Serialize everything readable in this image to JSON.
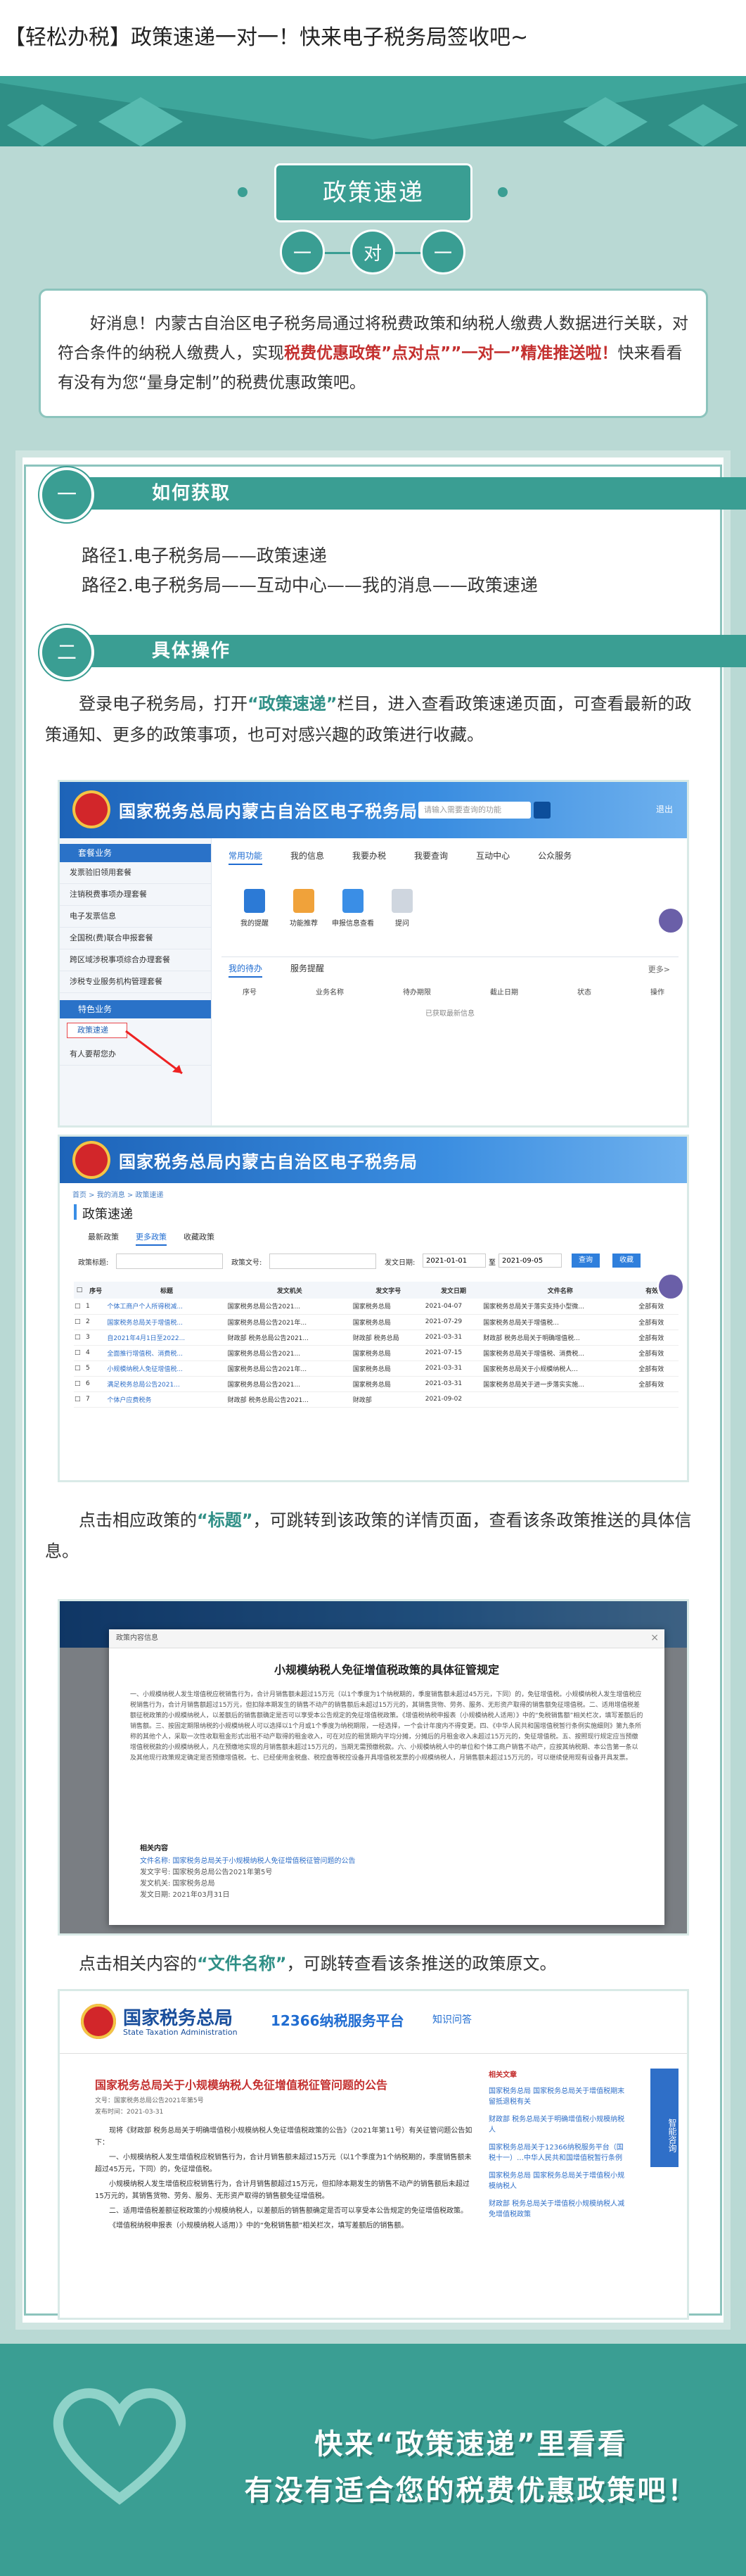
{
  "article": {
    "title": "【轻松办税】政策速递一对一！快来电子税务局签收吧~"
  },
  "section": {
    "ribbon": "政策速递",
    "circles": [
      "一",
      "对",
      "一"
    ]
  },
  "intro": {
    "part1": "好消息！内蒙古自治区电子税务局通过将税费政策和纳税人缴费人数据进行关联，对符合条件的纳税人缴费人，实现",
    "highlight": "税费优惠政策”点对点””一对一”精准推送啦！",
    "part2": "快来看看有没有为您“量身定制”的税费优惠政策吧。"
  },
  "steps": [
    {
      "num": "一",
      "title": "如何获取"
    },
    {
      "num": "二",
      "title": "具体操作"
    }
  ],
  "paths": [
    "路径1.电子税务局——政策速递",
    "路径2.电子税务局——互动中心——我的消息——政策速递"
  ],
  "paragraphs": {
    "p1_a": "登录电子税务局，打开",
    "p1_em": "“政策速递”",
    "p1_b": "栏目，进入查看政策速递页面，可查看最新的政策通知、更多的政策事项，也可对感兴趣的政策进行收藏。",
    "p2_a": "点击相应政策的",
    "p2_em": "“标题”",
    "p2_b": "，可跳转到该政策的详情页面，查看该条政策推送的具体信息。",
    "p3_a": "点击相关内容的",
    "p3_em": "“文件名称”",
    "p3_b": "，可跳转查看该条推送的政策原文。"
  },
  "shot1": {
    "header_title": "国家税务总局内蒙古自治区电子税务局",
    "search_placeholder": "请输入需要查询的功能",
    "util": "退出",
    "sidebar_title": "套餐业务",
    "sidebar_items": [
      "发票验旧领用套餐",
      "注销税费事项办理套餐",
      "电子发票信息",
      "全国税(费)联合申报套餐",
      "跨区域涉税事项综合办理套餐",
      "涉税专业服务机构管理套餐"
    ],
    "sidebar_title2": "特色业务",
    "sidebar_sel": "政策速递",
    "sidebar_item_last": "有人要帮您办",
    "tabs": [
      "常用功能",
      "我的信息",
      "我要办税",
      "我要查询",
      "互动中心",
      "公众服务"
    ],
    "quick": [
      "我的提醒",
      "功能推荐",
      "申报信息查看",
      "提问"
    ],
    "lower_tabs": [
      "我的待办",
      "服务提醒"
    ],
    "lower_more": "更多>",
    "table_cols": [
      "序号",
      "业务名称",
      "待办期限",
      "截止日期",
      "状态",
      "操作"
    ],
    "empty": "已获取最新信息"
  },
  "shot2": {
    "header_title": "国家税务总局内蒙古自治区电子税务局",
    "breadcrumb": "首页 > 我的消息 > 政策速递",
    "page_title": "政策速递",
    "tabs": [
      "最新政策",
      "更多政策",
      "收藏政策"
    ],
    "filters": [
      "政策标题:",
      "政策文号:",
      "发文日期:"
    ],
    "date_from": "2021-01-01",
    "date_sep": "至",
    "date_to": "2021-09-05",
    "btn_search": "查询",
    "btn_reset": "收藏",
    "cols": [
      "序号",
      "标题",
      "发文机关",
      "发文字号",
      "发文日期",
      "文件名称",
      "有效状态"
    ],
    "rows": [
      [
        "1",
        "个体工商户个人所得税减...",
        "国家税务总局公告2021...",
        "国家税务总局",
        "2021-04-07",
        "国家税务总局关于落实支持小型微...",
        "全部有效"
      ],
      [
        "2",
        "国家税务总局关于增值税...",
        "国家税务总局公告2021年...",
        "国家税务总局",
        "2021-07-29",
        "国家税务总局关于增值税...",
        "全部有效"
      ],
      [
        "3",
        "自2021年4月1日至2022...",
        "财政部 税务总局公告2021...",
        "财政部 税务总局",
        "2021-03-31",
        "财政部 税务总局关于明确增值税...",
        "全部有效"
      ],
      [
        "4",
        "全面推行增值税、消费税...",
        "国家税务总局公告2021...",
        "国家税务总局",
        "2021-07-15",
        "国家税务总局关于增值税、消费税...",
        "全部有效"
      ],
      [
        "5",
        "小规模纳税人免征增值税...",
        "国家税务总局公告2021年...",
        "国家税务总局",
        "2021-03-31",
        "国家税务总局关于小规模纳税人...",
        "全部有效"
      ],
      [
        "6",
        "满足税务总局公告2021...",
        "国家税务总局公告2021...",
        "国家税务总局",
        "2021-03-31",
        "国家税务总局关于进一步落实实施...",
        "全部有效"
      ],
      [
        "7",
        "个体户应费税务",
        "财政部 税务总局公告2021...",
        "财政部",
        "2021-09-02",
        "",
        ""
      ]
    ]
  },
  "shot3": {
    "modal_label": "政策内容信息",
    "modal_title": "小规模纳税人免征增值税政策的具体征管规定",
    "modal_body": "一、小规模纳税人发生增值税应税销售行为，合计月销售额未超过15万元（以1个季度为1个纳税期的，季度销售额未超过45万元，下同）的，免征增值税。小规模纳税人发生增值税应税销售行为，合计月销售额超过15万元，但扣除本期发生的销售不动产的销售额后未超过15万元的，其销售货物、劳务、服务、无形资产取得的销售额免征增值税。二、适用增值税差额征税政策的小规模纳税人，以差额后的销售额确定是否可以享受本公告规定的免征增值税政策。《增值税纳税申报表（小规模纳税人适用）》中的“免税销售额”相关栏次，填写差额后的销售额。三、按固定期限纳税的小规模纳税人可以选择以1个月或1个季度为纳税期限，一经选择，一个会计年度内不得变更。四、《中华人民共和国增值税暂行条例实施细则》第九条所称的其他个人，采取一次性收取租金形式出租不动产取得的租金收入，可在对应的租赁期内平均分摊，分摊后的月租金收入未超过15万元的，免征增值税。五、按照现行规定应当预缴增值税税款的小规模纳税人，凡在预缴地实现的月销售额未超过15万元的，当期无需预缴税款。六、小规模纳税人中的单位和个体工商户销售不动产，应按其纳税期、本公告第一条以及其他现行政策规定确定是否预缴增值税。七、已经使用金税盘、税控盘等税控设备开具增值税发票的小规模纳税人，月销售额未超过15万元的，可以继续使用现有设备开具发票。",
    "meta_head": "相关内容",
    "meta": [
      "文件名称:  国家税务总局关于小规模纳税人免征增值税征管问题的公告",
      "发文字号:  国家税务总局公告2021年第5号",
      "发文机关:  国家税务总局",
      "发文日期:  2021年03月31日"
    ]
  },
  "shot4": {
    "org_cn": "国家税务总局",
    "org_en": "State Taxation Administration",
    "hotline": "12366纳税服务平台",
    "smart": "知识问答",
    "doc_title": "国家税务总局关于小规模纳税人免征增值税征管问题的公告",
    "doc_no": "文号：国家税务总局公告2021年第5号",
    "doc_date": "发布时间：2021-03-31",
    "doc_body": [
      "现将《财政部 税务总局关于明确增值税小规模纳税人免征增值税政策的公告》（2021年第11号）有关征管问题公告如下：",
      "一、小规模纳税人发生增值税应税销售行为，合计月销售额未超过15万元（以1个季度为1个纳税期的，季度销售额未超过45万元，下同）的，免征增值税。",
      "小规模纳税人发生增值税应税销售行为，合计月销售额超过15万元，但扣除本期发生的销售不动产的销售额后未超过15万元的，其销售货物、劳务、服务、无形资产取得的销售额免征增值税。",
      "二、适用增值税差额征税政策的小规模纳税人，以差额后的销售额确定是否可以享受本公告规定的免征增值税政策。",
      "《增值税纳税申报表（小规模纳税人适用）》中的“免税销售额”相关栏次，填写差额后的销售额。"
    ],
    "side_head": "相关文章",
    "side_items": [
      "国家税务总局 国家税务总局关于增值税期末留抵退税有关",
      "财政部 税务总局关于明确增值税小规模纳税人",
      "国家税务总局关于12366纳税服务平台（国税十一）…中华人民共和国增值税暂行条例",
      "国家税务总局 国家税务总局关于增值税小规模纳税人",
      "财政部 税务总局关于增值税小规模纳税人减免增值税政策"
    ],
    "robot": "智能咨询"
  },
  "ending": {
    "line1": "快来“政策速递”里看看",
    "line2": "有没有适合您的税费优惠政策吧！"
  }
}
